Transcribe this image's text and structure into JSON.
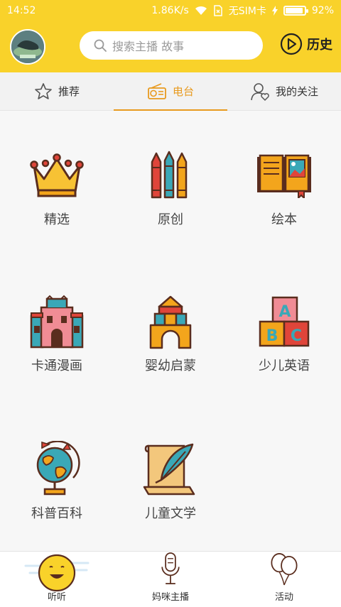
{
  "status_bar": {
    "time": "14:52",
    "speed": "1.86K/s",
    "sim": "无SIM卡",
    "battery_text": "92%",
    "battery_level": 0.92
  },
  "header": {
    "search_placeholder": "搜索主播 故事",
    "history_label": "历史"
  },
  "tabs": [
    {
      "label": "推荐",
      "icon": "star-icon",
      "active": false
    },
    {
      "label": "电台",
      "icon": "radio-icon",
      "active": true
    },
    {
      "label": "我的关注",
      "icon": "user-heart-icon",
      "active": false
    }
  ],
  "categories": [
    {
      "label": "精选",
      "icon": "crown-icon"
    },
    {
      "label": "原创",
      "icon": "crayons-icon"
    },
    {
      "label": "绘本",
      "icon": "picture-book-icon"
    },
    {
      "label": "卡通漫画",
      "icon": "castle-icon"
    },
    {
      "label": "婴幼启蒙",
      "icon": "blocks-icon"
    },
    {
      "label": "少儿英语",
      "icon": "abc-blocks-icon"
    },
    {
      "label": "科普百科",
      "icon": "globe-icon"
    },
    {
      "label": "儿童文学",
      "icon": "scroll-quill-icon"
    }
  ],
  "bottom_nav": [
    {
      "label": "听听",
      "icon": "smiley-face-icon",
      "active": true
    },
    {
      "label": "妈咪主播",
      "icon": "microphone-icon",
      "active": false
    },
    {
      "label": "活动",
      "icon": "balloons-icon",
      "active": false
    }
  ],
  "colors": {
    "brand_yellow": "#f9d22a",
    "accent_orange": "#e89a1e"
  }
}
